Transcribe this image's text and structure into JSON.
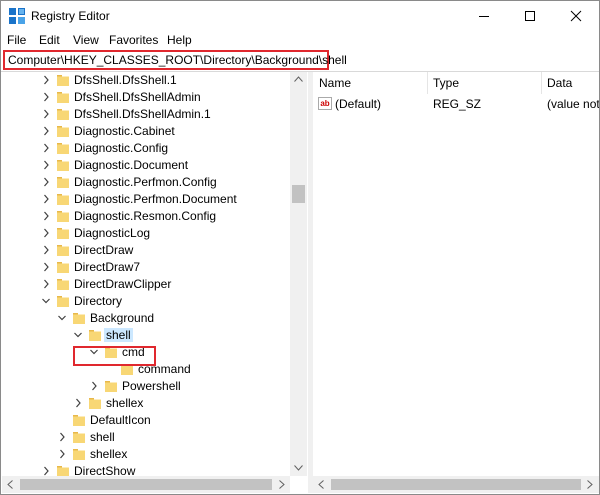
{
  "window": {
    "title": "Registry Editor"
  },
  "menu": [
    "File",
    "Edit",
    "View",
    "Favorites",
    "Help"
  ],
  "address": "Computer\\HKEY_CLASSES_ROOT\\Directory\\Background\\shell",
  "tree": {
    "items": [
      {
        "label": "DfsShell.DfsShell.1"
      },
      {
        "label": "DfsShell.DfsShellAdmin"
      },
      {
        "label": "DfsShell.DfsShellAdmin.1"
      },
      {
        "label": "Diagnostic.Cabinet"
      },
      {
        "label": "Diagnostic.Config"
      },
      {
        "label": "Diagnostic.Document"
      },
      {
        "label": "Diagnostic.Perfmon.Config"
      },
      {
        "label": "Diagnostic.Perfmon.Document"
      },
      {
        "label": "Diagnostic.Resmon.Config"
      },
      {
        "label": "DiagnosticLog"
      },
      {
        "label": "DirectDraw"
      },
      {
        "label": "DirectDraw7"
      },
      {
        "label": "DirectDrawClipper"
      },
      {
        "label": "Directory"
      },
      {
        "label": "Background"
      },
      {
        "label": "shell"
      },
      {
        "label": "cmd"
      },
      {
        "label": "command"
      },
      {
        "label": "Powershell"
      },
      {
        "label": "shellex"
      },
      {
        "label": "DefaultIcon"
      },
      {
        "label": "shell"
      },
      {
        "label": "shellex"
      },
      {
        "label": "DirectShow"
      }
    ]
  },
  "values_pane": {
    "columns": [
      "Name",
      "Type",
      "Data"
    ],
    "rows": [
      {
        "name": "(Default)",
        "type": "REG_SZ",
        "data": "(value not"
      }
    ],
    "icon_text": "ab"
  },
  "colors": {
    "highlight": "#e0282e",
    "selection": "#cce8ff",
    "folder": "#f8d775"
  }
}
